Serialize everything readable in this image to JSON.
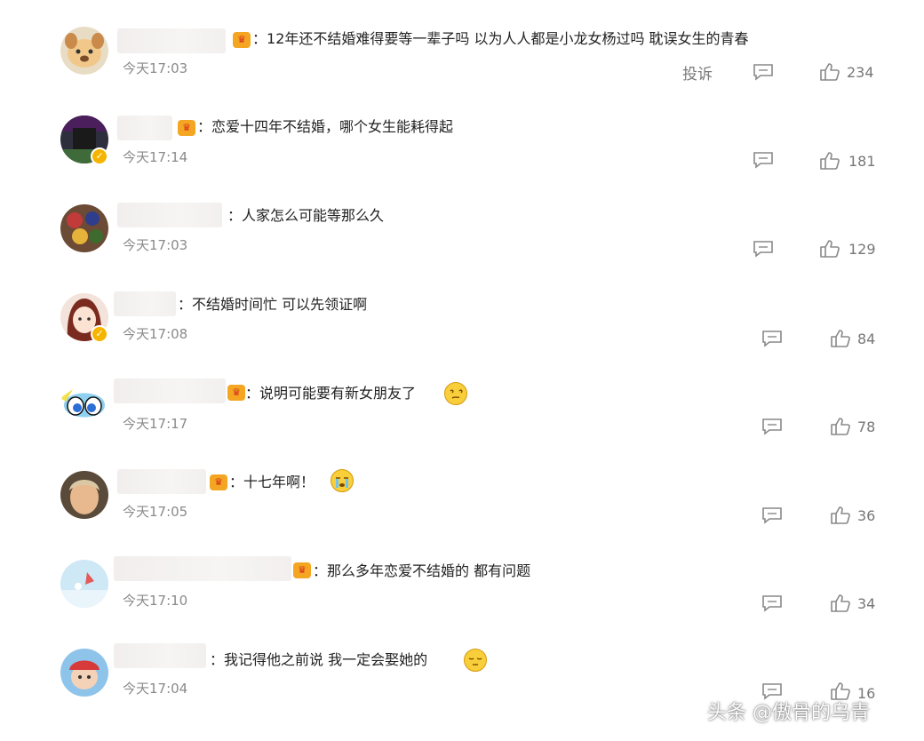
{
  "report_label": "投诉",
  "watermark": "头条 @傲骨的乌青",
  "colors": {
    "badge": "#f4a622",
    "verified": "#f5b400",
    "emoji": "#f8cf3a"
  },
  "comments": [
    {
      "text": "12年还不结婚难得要等一辈子吗 以为人人都是小龙女杨过吗 耽误女生的青春",
      "time": "今天17:03",
      "likes": "234",
      "badge": "vip-crown",
      "avatar": "dog-cartoon"
    },
    {
      "text": "恋爱十四年不结婚，哪个女生能耗得起",
      "time": "今天17:14",
      "likes": "181",
      "badge": "vip-crown",
      "avatar": "dark-portrait",
      "verified": true
    },
    {
      "text": "人家怎么可能等那么久",
      "time": "今天17:03",
      "likes": "129",
      "avatar": "colorful-photo"
    },
    {
      "text": "不结婚时间忙 可以先领证啊",
      "time": "今天17:08",
      "likes": "84",
      "avatar": "anime-girl",
      "verified": true
    },
    {
      "text": "说明可能要有新女朋友了",
      "time": "今天17:17",
      "likes": "78",
      "badge": "vip-crown",
      "avatar": "powerpuff-girl",
      "emoji": "dizzy-face"
    },
    {
      "text": "十七年啊！",
      "time": "今天17:05",
      "likes": "36",
      "badge": "vip-crown",
      "avatar": "person-photo",
      "emoji": "crying-face"
    },
    {
      "text": "那么多年恋爱不结婚的 都有问题",
      "time": "今天17:10",
      "likes": "34",
      "badge": "vip-crown",
      "avatar": "sky-illustration"
    },
    {
      "text": "我记得他之前说 我一定会娶她的",
      "time": "今天17:04",
      "likes": "16",
      "avatar": "cartoon-character",
      "emoji": "sleepy-face"
    }
  ]
}
